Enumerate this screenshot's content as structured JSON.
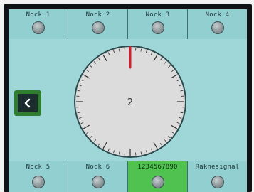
{
  "top_row": [
    {
      "label": "Nock 1",
      "active": false
    },
    {
      "label": "Nock 2",
      "active": false
    },
    {
      "label": "Nock 3",
      "active": false
    },
    {
      "label": "Nock 4",
      "active": false
    }
  ],
  "bottom_row": [
    {
      "label": "Nock 5",
      "active": false
    },
    {
      "label": "Nock 6",
      "active": false
    },
    {
      "label": "1234567890",
      "active": true
    },
    {
      "label": "Räknesignal",
      "active": false
    }
  ],
  "dial": {
    "center_value": "2",
    "pointer_position": 0,
    "tick_count": 60
  },
  "colors": {
    "tile": "#91cfd1",
    "tile_active": "#4fc24f",
    "screen": "#9fd6d8",
    "dial_face": "#dcdcdc",
    "pointer": "#d21f2e"
  },
  "icons": {
    "back": "chevron-left-icon",
    "indicator": "indicator-knob-icon"
  }
}
